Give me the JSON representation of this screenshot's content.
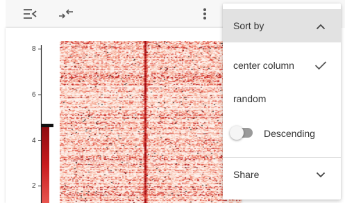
{
  "toolbar": {
    "collapse_icon": "menu-collapse-icon",
    "swap_icon": "swap-arrows-icon",
    "more_icon": "more-vert-icon"
  },
  "axis": {
    "ticks": [
      "8",
      "6",
      "4",
      "2"
    ]
  },
  "colors": {
    "heat_high": "#c0141a",
    "heat_low": "#fdeee8",
    "menu_header_bg": "#e2e2e2",
    "toggle_off": "#9a9a9a"
  },
  "menu": {
    "sort_by_label": "Sort by",
    "options": [
      {
        "label": "center column",
        "selected": true
      },
      {
        "label": "random",
        "selected": false
      }
    ],
    "descending_label": "Descending",
    "descending_on": false,
    "share_label": "Share"
  }
}
